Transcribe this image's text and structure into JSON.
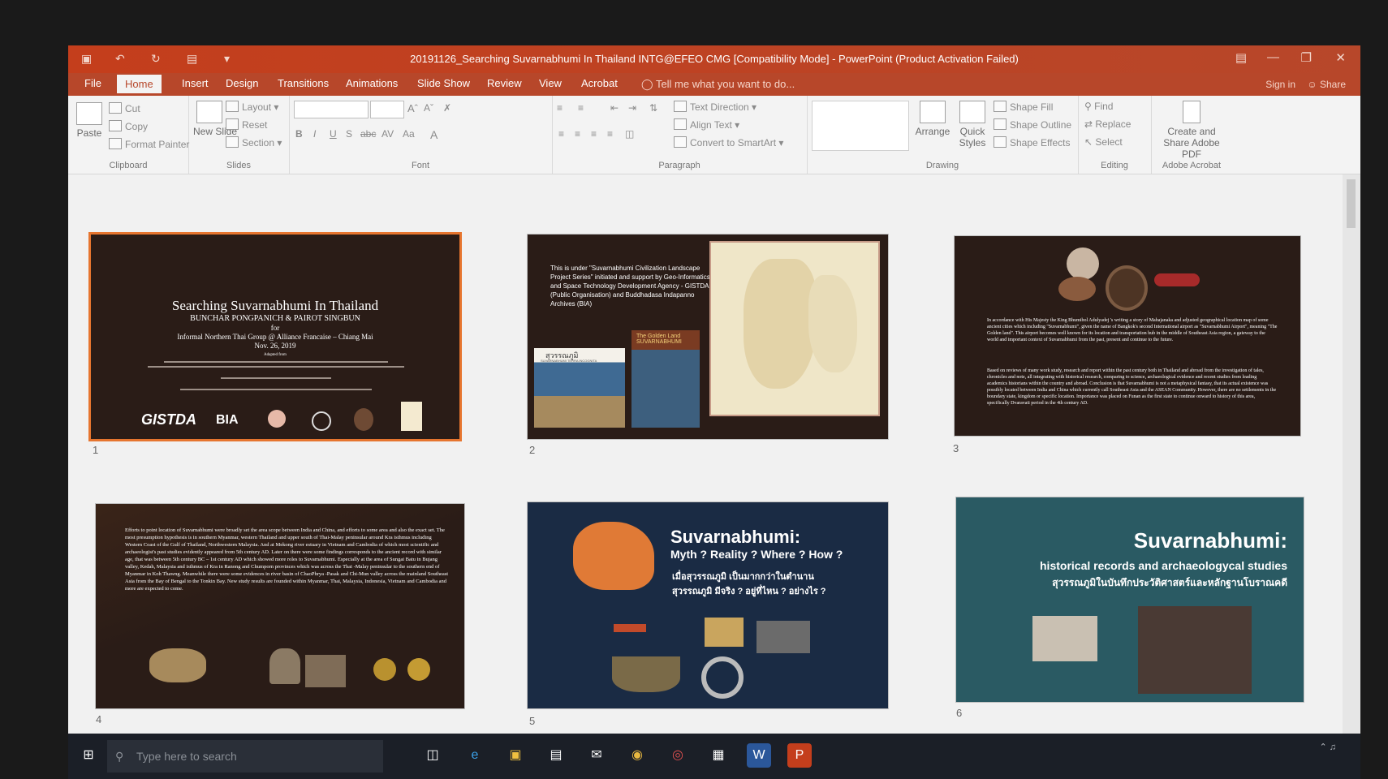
{
  "window": {
    "title": "20191126_Searching Suvarnabhumi In Thailand INTG@EFEO CMG [Compatibility Mode] - PowerPoint (Product Activation Failed)"
  },
  "tabs": [
    "File",
    "Home",
    "Insert",
    "Design",
    "Transitions",
    "Animations",
    "Slide Show",
    "Review",
    "View",
    "Acrobat"
  ],
  "active_tab": "Home",
  "tell_me": "Tell me what you want to do...",
  "account": {
    "signin": "Sign in",
    "share": "Share"
  },
  "ribbon": {
    "clipboard": {
      "label": "Clipboard",
      "paste": "Paste",
      "cut": "Cut",
      "copy": "Copy",
      "format_painter": "Format Painter"
    },
    "slides": {
      "label": "Slides",
      "new_slide": "New Slide",
      "layout": "Layout",
      "reset": "Reset",
      "section": "Section"
    },
    "font": {
      "label": "Font",
      "buttons": [
        "B",
        "I",
        "U",
        "S",
        "abc",
        "AV",
        "Aa",
        "A"
      ]
    },
    "paragraph": {
      "label": "Paragraph",
      "text_direction": "Text Direction",
      "align_text": "Align Text",
      "convert_smartart": "Convert to SmartArt"
    },
    "drawing": {
      "label": "Drawing",
      "arrange": "Arrange",
      "quick_styles": "Quick Styles",
      "shape_fill": "Shape Fill",
      "shape_outline": "Shape Outline",
      "shape_effects": "Shape Effects"
    },
    "editing": {
      "label": "Editing",
      "find": "Find",
      "replace": "Replace",
      "select": "Select"
    },
    "acrobat": {
      "label": "Adobe Acrobat",
      "create": "Create and Share Adobe PDF"
    }
  },
  "slides": [
    {
      "number": "1",
      "title": "Searching Suvarnabhumi In Thailand",
      "authors": "BUNCHAR PONGPANICH & PAIROT SINGBUN",
      "for": "for",
      "venue": "Informal Northern Thai Group @ Alliance Francaise  – Chiang Mai",
      "date": "Nov. 26, 2019",
      "adapted": "Adapted from",
      "logos": [
        "GISTDA",
        "BIA"
      ]
    },
    {
      "number": "2",
      "text": "This is under \"Suvarnabhumi Civilization Landscape Project Series\" initiated and support by Geo-Informatics and Space Technology Development Agency - GISTDA (Public Organisation) and Buddhadasa Indapanno Archives (BIA)",
      "book1": "สุวรรณภูมิ",
      "book1_sub": "SUVARNABHUMI TERRA INCOGNITA",
      "book2": "The Golden Land SUVARNABHUMI"
    },
    {
      "number": "3",
      "para1": "In accordance with His Majesty the King Bhumibol Adulyadej 's writing a story of Mahajanaka and adjusted geographical location map of some ancient cities which including \"Suvarnabhumi\", given the name of Bangkok's second International airport as \"Suvarnabhumi Airport\", meaning \"The Golden land\". This airport becomes well known for its location and transportation hub in the middle of Southeast Asia region, a gateway to the world and important context of Suvarnabhumi from the past, present and continue to the future.",
      "para2": "Based on reviews of many work study, research and report within the past century both in Thailand and abroad from the investigation of tales, chronicles and note, all integrating with historical research, comparing to science, archaeological evidence and recent studies from leading academics historians within the country and abroad. Conclusion is that Suvarnabhumi is not a metaphysical fantasy, that its actual existence was possibly located between India and China which currently call Southeast Asia and the ASEAN Community. However, there are no settlements in the boundary state, kingdom or specific location. Importance was placed on Funan as the first state to continue onward to history of this area, specifically Dvaravati period in the 4th century AD."
    },
    {
      "number": "4",
      "text": "Efforts to point location of Suvarnabhumi were broadly set the area scope between India and China, and efforts to some area and also the exact set. The most presumption hypothesis is in southern Myanmar, western Thailand and upper south of Thai-Malay peninsular around Kra isthmus including Western Coast of the Gulf of Thailand, Northwestern Malaysia. And at Mekong river estuary in Vietnam and Cambodia of which most scientific and archaeologist's past studies evidently appeared from 5th century AD. Later on there were some findings corresponds to the ancient record with similar age, that was between 5th century BC – 1st century AD which showed more roles to Suvarnabhumi. Especially at the area of Sungai Batu in Bujang valley, Kedah, Malaysia and isthmus of Kra in Ranong and Chumporn provinces which was across the Thai -Malay peninsular to the southern end of Myanmar in Koh Thawng. Meanwhile there were some evidences in river basin of ChaoPhrya -Pasak and Chi-Mun valley across the mainland Southeast Asia from the Bay of Bengal to the Tonkin Bay. New study results are founded within Myanmar, Thai, Malaysia, Indonesia, Vietnam and Cambodia and more are expected to come."
    },
    {
      "number": "5",
      "title": "Suvarnabhumi:",
      "subtitle": "Myth ? Reality ? Where ? How ?",
      "thai1": "เมื่อสุวรรณภูมิ เป็นมากกว่าในตำนาน",
      "thai2": "สุวรรณภูมิ มีจริง ? อยู่ที่ไหน ? อย่างไร ?"
    },
    {
      "number": "6",
      "title": "Suvarnabhumi:",
      "subtitle": "historical records and archaeologycal studies",
      "thai": "สุวรรณภูมิในบันทึกประวัติศาสตร์และหลักฐานโบราณคดี"
    }
  ],
  "taskbar": {
    "search_placeholder": "Type here to search"
  },
  "colors": {
    "accent": "#b7472a",
    "selection": "#e6752f",
    "slide_dark": "#2a1c17",
    "slide_navy": "#1a2b44",
    "slide_teal": "#2a5a63"
  }
}
